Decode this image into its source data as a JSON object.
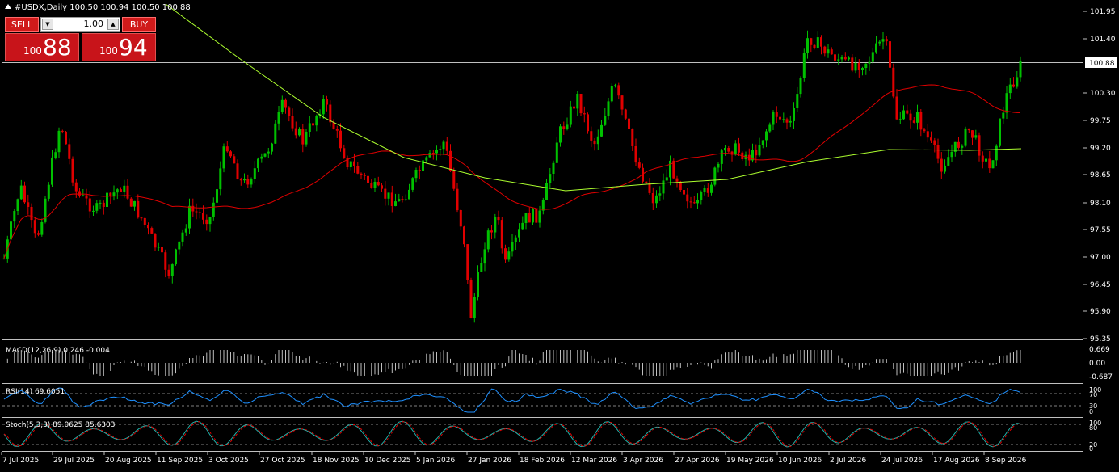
{
  "chart": {
    "symbol_title": "#USDX,Daily  100.50 100.94 100.50 100.88",
    "current_price_label": "100.88",
    "price_axis_labels": [
      "101.95",
      "101.40",
      "100.30",
      "99.75",
      "99.20",
      "98.65",
      "98.10",
      "97.55",
      "97.00",
      "96.45",
      "95.90",
      "95.35"
    ],
    "date_labels": [
      "7 Jul 2025",
      "29 Jul 2025",
      "20 Aug 2025",
      "11 Sep 2025",
      "3 Oct 2025",
      "27 Oct 2025",
      "18 Nov 2025",
      "10 Dec 2025",
      "5 Jan 2026",
      "27 Jan 2026",
      "18 Feb 2026",
      "12 Mar 2026",
      "3 Apr 2026",
      "27 Apr 2026",
      "19 May 2026",
      "10 Jun 2026",
      "2 Jul 2026",
      "24 Jul 2026",
      "17 Aug 2026",
      "8 Sep 2026"
    ],
    "colors": {
      "bull": "#00c000",
      "bear": "#e00000",
      "ma_fast": "#e00000",
      "ma_slow": "#adff2f",
      "macd_hist": "#c0c0c0",
      "macd_signal": "#e00000",
      "rsi": "#1e90ff",
      "stoch_main": "#20b2aa",
      "stoch_signal": "#e00000"
    }
  },
  "trade_panel": {
    "sell_label": "SELL",
    "buy_label": "BUY",
    "lot_value": "1.00",
    "sell_small": "100",
    "sell_big": "88",
    "buy_small": "100",
    "buy_big": "94"
  },
  "macd": {
    "title": "MACD(12,26,9) 0.246 -0.004",
    "axis_labels": [
      "0.669",
      "0.00",
      "-0.687"
    ]
  },
  "rsi": {
    "title": "RSI(14) 69.6051",
    "axis_labels": [
      "100",
      "70",
      "30",
      "0"
    ]
  },
  "stoch": {
    "title": "Stoch(5,3,3) 89.0625 85.6303",
    "axis_labels": [
      "100",
      "80",
      "20",
      "0"
    ]
  }
}
